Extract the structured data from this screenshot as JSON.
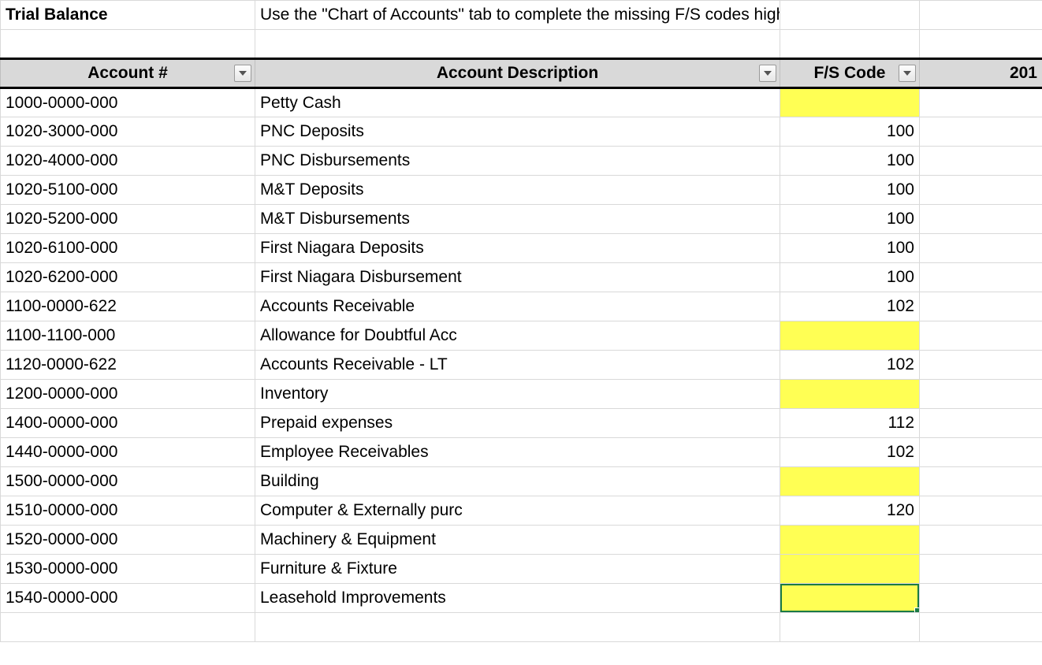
{
  "title": "Trial Balance",
  "instruction": "Use the \"Chart of Accounts\" tab to complete the missing F/S codes highlighted in yellow.",
  "headers": {
    "account_num": "Account #",
    "account_desc": "Account Description",
    "fs_code": "F/S Code",
    "year": "201"
  },
  "rows": [
    {
      "acct": "1000-0000-000",
      "desc": "Petty Cash",
      "code": "",
      "hl": true,
      "sel": false
    },
    {
      "acct": "1020-3000-000",
      "desc": "PNC Deposits",
      "code": "100",
      "hl": false,
      "sel": false
    },
    {
      "acct": "1020-4000-000",
      "desc": "PNC Disbursements",
      "code": "100",
      "hl": false,
      "sel": false
    },
    {
      "acct": "1020-5100-000",
      "desc": "M&T Deposits",
      "code": "100",
      "hl": false,
      "sel": false
    },
    {
      "acct": "1020-5200-000",
      "desc": "M&T Disbursements",
      "code": "100",
      "hl": false,
      "sel": false
    },
    {
      "acct": "1020-6100-000",
      "desc": "First Niagara Deposits",
      "code": "100",
      "hl": false,
      "sel": false
    },
    {
      "acct": "1020-6200-000",
      "desc": "First Niagara Disbursement",
      "code": "100",
      "hl": false,
      "sel": false
    },
    {
      "acct": "1100-0000-622",
      "desc": "Accounts Receivable",
      "code": "102",
      "hl": false,
      "sel": false
    },
    {
      "acct": "1100-1100-000",
      "desc": "Allowance for Doubtful Acc",
      "code": "",
      "hl": true,
      "sel": false
    },
    {
      "acct": "1120-0000-622",
      "desc": "Accounts Receivable - LT",
      "code": "102",
      "hl": false,
      "sel": false
    },
    {
      "acct": "1200-0000-000",
      "desc": "Inventory",
      "code": "",
      "hl": true,
      "sel": false
    },
    {
      "acct": "1400-0000-000",
      "desc": "Prepaid expenses",
      "code": "112",
      "hl": false,
      "sel": false
    },
    {
      "acct": "1440-0000-000",
      "desc": "Employee Receivables",
      "code": "102",
      "hl": false,
      "sel": false
    },
    {
      "acct": "1500-0000-000",
      "desc": "Building",
      "code": "",
      "hl": true,
      "sel": false
    },
    {
      "acct": "1510-0000-000",
      "desc": "Computer & Externally purc",
      "code": "120",
      "hl": false,
      "sel": false
    },
    {
      "acct": "1520-0000-000",
      "desc": "Machinery & Equipment",
      "code": "",
      "hl": true,
      "sel": false
    },
    {
      "acct": "1530-0000-000",
      "desc": "Furniture & Fixture",
      "code": "",
      "hl": true,
      "sel": false
    },
    {
      "acct": "1540-0000-000",
      "desc": "Leasehold Improvements",
      "code": "",
      "hl": true,
      "sel": true
    }
  ]
}
